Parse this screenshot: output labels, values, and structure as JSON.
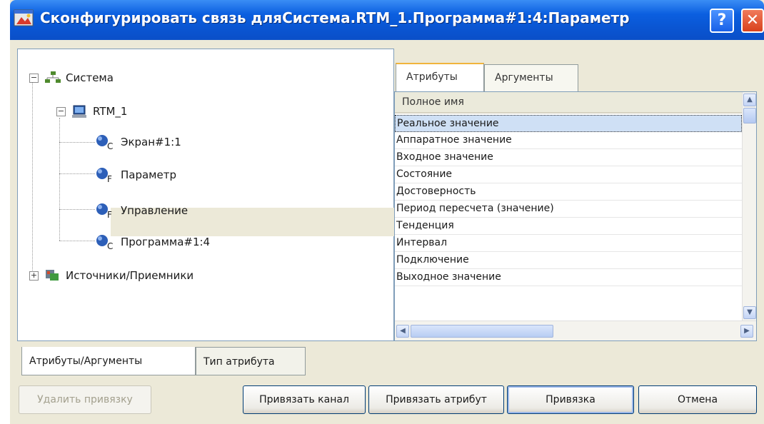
{
  "window": {
    "title": "Сконфигурировать связь дляСистема.RTM_1.Программа#1:4:Параметр",
    "help_label": "?",
    "close_label": "✕"
  },
  "tree": {
    "items": [
      {
        "label": "Система",
        "expander": "−",
        "icon": "network-icon"
      },
      {
        "label": "RTM_1",
        "expander": "−",
        "icon": "computer-icon"
      },
      {
        "label": "Экран#1:1",
        "icon": "component-c-icon",
        "sub": "C"
      },
      {
        "label": "Параметр",
        "icon": "component-f-icon",
        "sub": "F"
      },
      {
        "label": "Управление",
        "icon": "component-f-icon",
        "sub": "F"
      },
      {
        "label": "Программа#1:4",
        "icon": "component-c-icon",
        "sub": "C"
      },
      {
        "label": "Источники/Приемники",
        "expander": "+",
        "icon": "sources-icon"
      }
    ]
  },
  "right_tabs": {
    "attributes": "Атрибуты",
    "arguments": "Аргументы"
  },
  "list": {
    "column_header": "Полное имя",
    "rows": [
      "Реальное значение",
      "Аппаратное значение",
      "Входное значение",
      "Состояние",
      "Достоверность",
      "Период пересчета (значение)",
      "Тенденция",
      "Интервал",
      "Подключение",
      "Выходное значение"
    ]
  },
  "bottom_tabs": {
    "attributes_arguments": "Атрибуты/Аргументы",
    "attribute_type": "Тип атрибута"
  },
  "buttons": {
    "remove_binding": "Удалить привязку",
    "bind_channel": "Привязать канал",
    "bind_attribute": "Привязать атрибут",
    "binding": "Привязка",
    "cancel": "Отмена"
  },
  "colors": {
    "titlebar": "#0b5fe0",
    "dialog_bg": "#ece9d8",
    "selection": "#cfe0f5"
  }
}
